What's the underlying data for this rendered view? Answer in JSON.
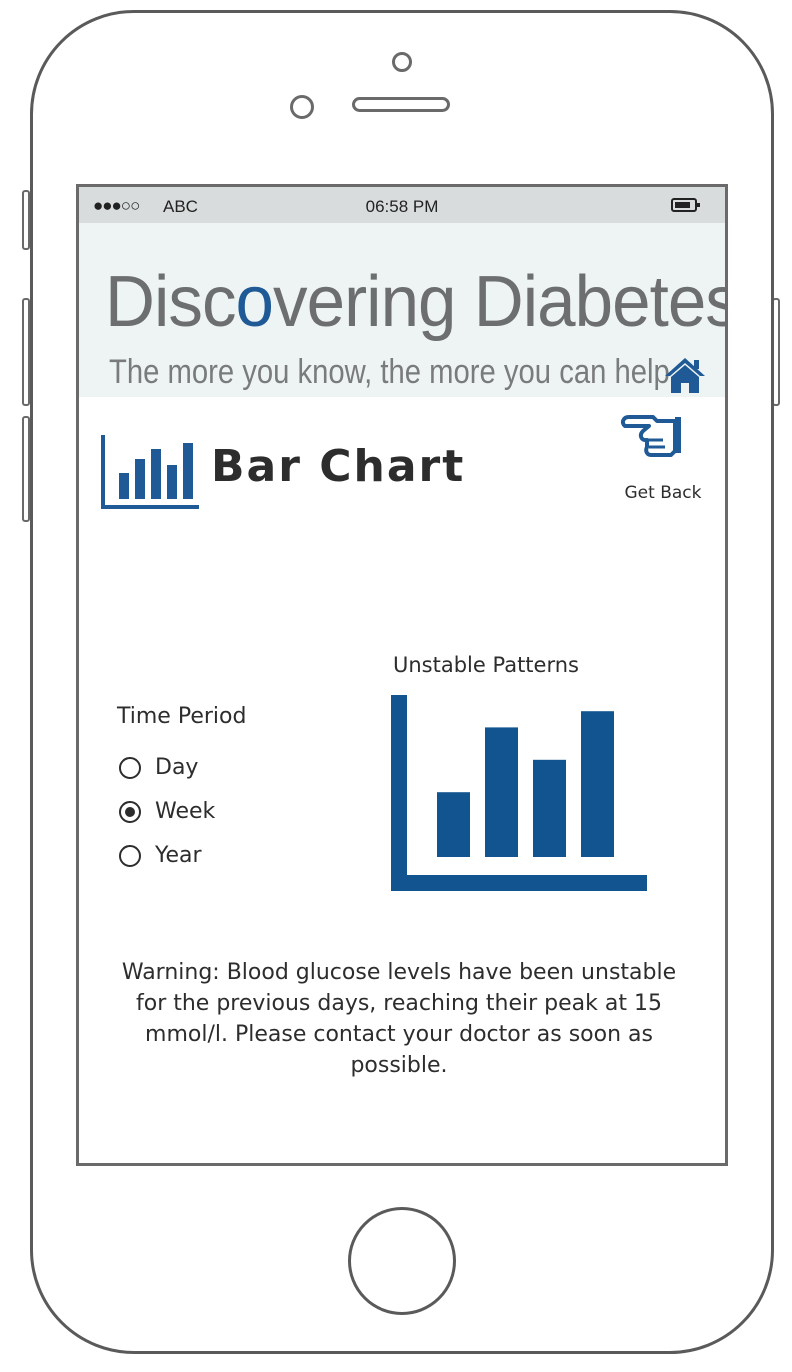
{
  "status_bar": {
    "signal": "●●●○○",
    "carrier": "ABC",
    "time": "06:58 PM",
    "battery_icon": "battery-icon"
  },
  "banner": {
    "title_part1": "Disc",
    "title_accent": "o",
    "title_part2": "vering Diabetes",
    "tagline": "The more you know, the more you can help.",
    "home_icon": "home-icon",
    "accent_color": "#1f5a96",
    "title_color": "#6d6e70"
  },
  "page": {
    "title": "Bar Chart",
    "icon": "bar-chart-icon"
  },
  "get_back": {
    "label": "Get Back",
    "icon": "pointing-hand-icon"
  },
  "time_period": {
    "label": "Time Period",
    "options": [
      {
        "label": "Day",
        "checked": false
      },
      {
        "label": "Week",
        "checked": true
      },
      {
        "label": "Year",
        "checked": false
      }
    ]
  },
  "chart_data": {
    "type": "bar",
    "title": "Unstable Patterns",
    "categories": [
      "",
      "",
      "",
      ""
    ],
    "values": [
      2,
      4,
      3,
      4.5
    ],
    "ylim": [
      0,
      5
    ],
    "xlabel": "",
    "ylabel": "",
    "grid": false,
    "bar_color": "#12548f"
  },
  "warning": {
    "text": "Warning: Blood glucose levels have been unstable for the previous days, reaching their peak at 15 mmol/l. Please contact your doctor as soon as possible."
  }
}
